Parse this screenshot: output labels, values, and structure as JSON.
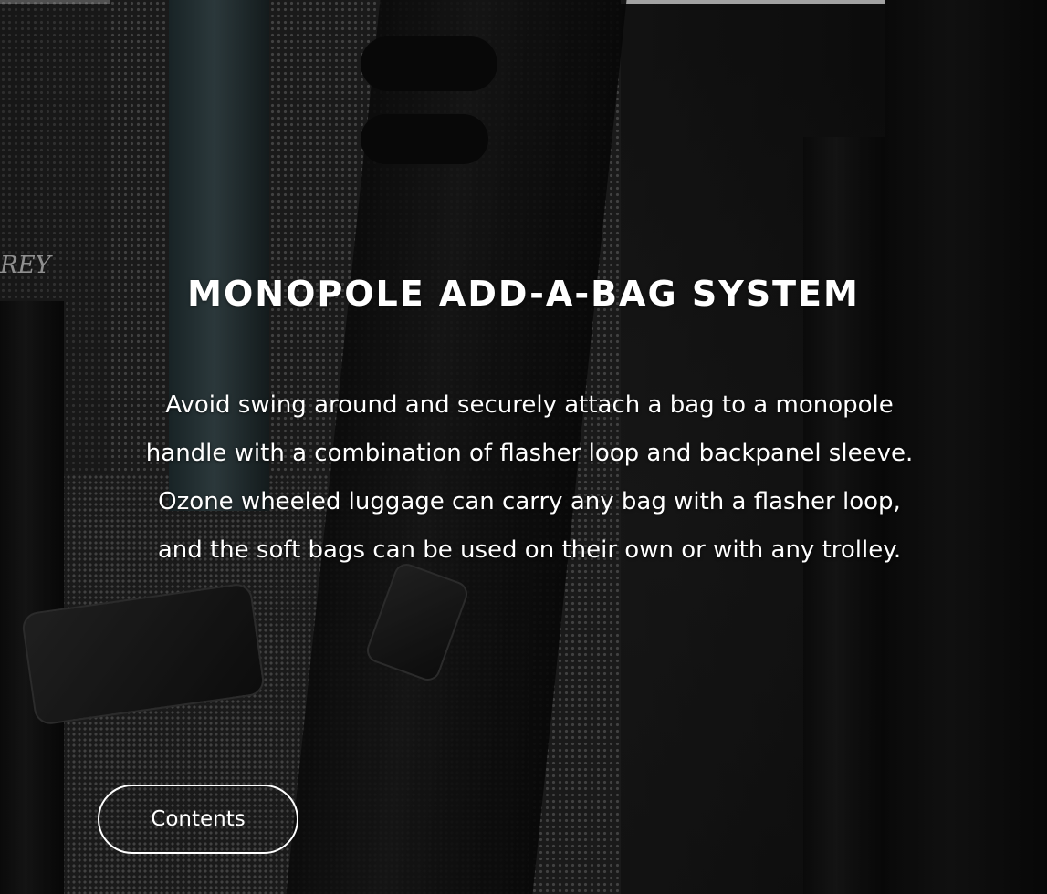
{
  "hero": {
    "title": "MONOPOLE ADD-A-BAG SYSTEM",
    "description": "Avoid swing around and securely attach a bag to a monopole handle with a combination of flasher loop and backpanel sleeve. Ozone wheeled luggage can carry any bag with a flasher loop, and the soft bags can be used on their own or with any trolley.",
    "button_label": "Contents",
    "brand_mark": "REY"
  },
  "colors": {
    "text": "#ffffff",
    "background": "#1a1a1a",
    "button_border": "#ffffff"
  }
}
